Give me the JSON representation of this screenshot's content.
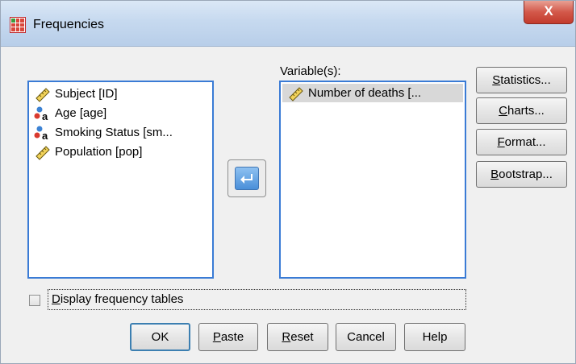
{
  "window": {
    "title": "Frequencies",
    "close_label": "X"
  },
  "source_list": {
    "items": [
      {
        "label": "Subject [ID]",
        "icon": "scale-ruler-icon"
      },
      {
        "label": "Age [age]",
        "icon": "nominal-variable-icon"
      },
      {
        "label": "Smoking Status [sm...",
        "icon": "nominal-variable-icon"
      },
      {
        "label": "Population [pop]",
        "icon": "scale-ruler-icon"
      }
    ]
  },
  "variables": {
    "label": "Variable(s):",
    "items": [
      {
        "label": "Number of deaths [...",
        "icon": "scale-ruler-icon",
        "selected": true
      }
    ]
  },
  "side_buttons": {
    "statistics": {
      "pre": "S",
      "post": "tatistics...",
      "underline": "S"
    },
    "charts": {
      "pre": "C",
      "post": "harts...",
      "underline": "C"
    },
    "format": {
      "pre": "F",
      "post": "ormat...",
      "underline": "F"
    },
    "bootstrap": {
      "pre": "B",
      "post": "ootstrap...",
      "underline": "B"
    }
  },
  "checkbox": {
    "underline": "D",
    "rest": "isplay frequency tables",
    "checked": false
  },
  "bottom_buttons": {
    "ok": "OK",
    "paste_u": "P",
    "paste_rest": "aste",
    "reset_u": "R",
    "reset_rest": "eset",
    "cancel": "Cancel",
    "help": "Help"
  },
  "colors": {
    "focus_border": "#3a7bd5",
    "title_bar": "#c6d9ef",
    "close_button": "#c9463a",
    "selection": "#d8d8d8"
  }
}
